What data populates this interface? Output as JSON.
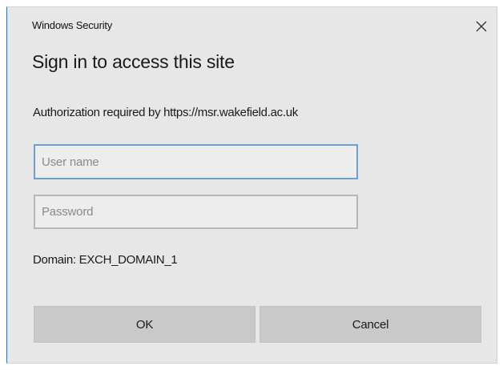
{
  "window": {
    "title": "Windows Security",
    "close_icon": "close-icon"
  },
  "dialog": {
    "heading": "Sign in to access this site",
    "authorization_text": "Authorization required by https://msr.wakefield.ac.uk",
    "domain_text": "Domain: EXCH_DOMAIN_1"
  },
  "form": {
    "username": {
      "value": "",
      "placeholder": "User name"
    },
    "password": {
      "value": "",
      "placeholder": "Password"
    }
  },
  "buttons": {
    "ok_label": "OK",
    "cancel_label": "Cancel"
  },
  "colors": {
    "dialog_background": "#e7e7e7",
    "focus_border": "#6f9fd0",
    "button_background": "#c9c9c9"
  }
}
